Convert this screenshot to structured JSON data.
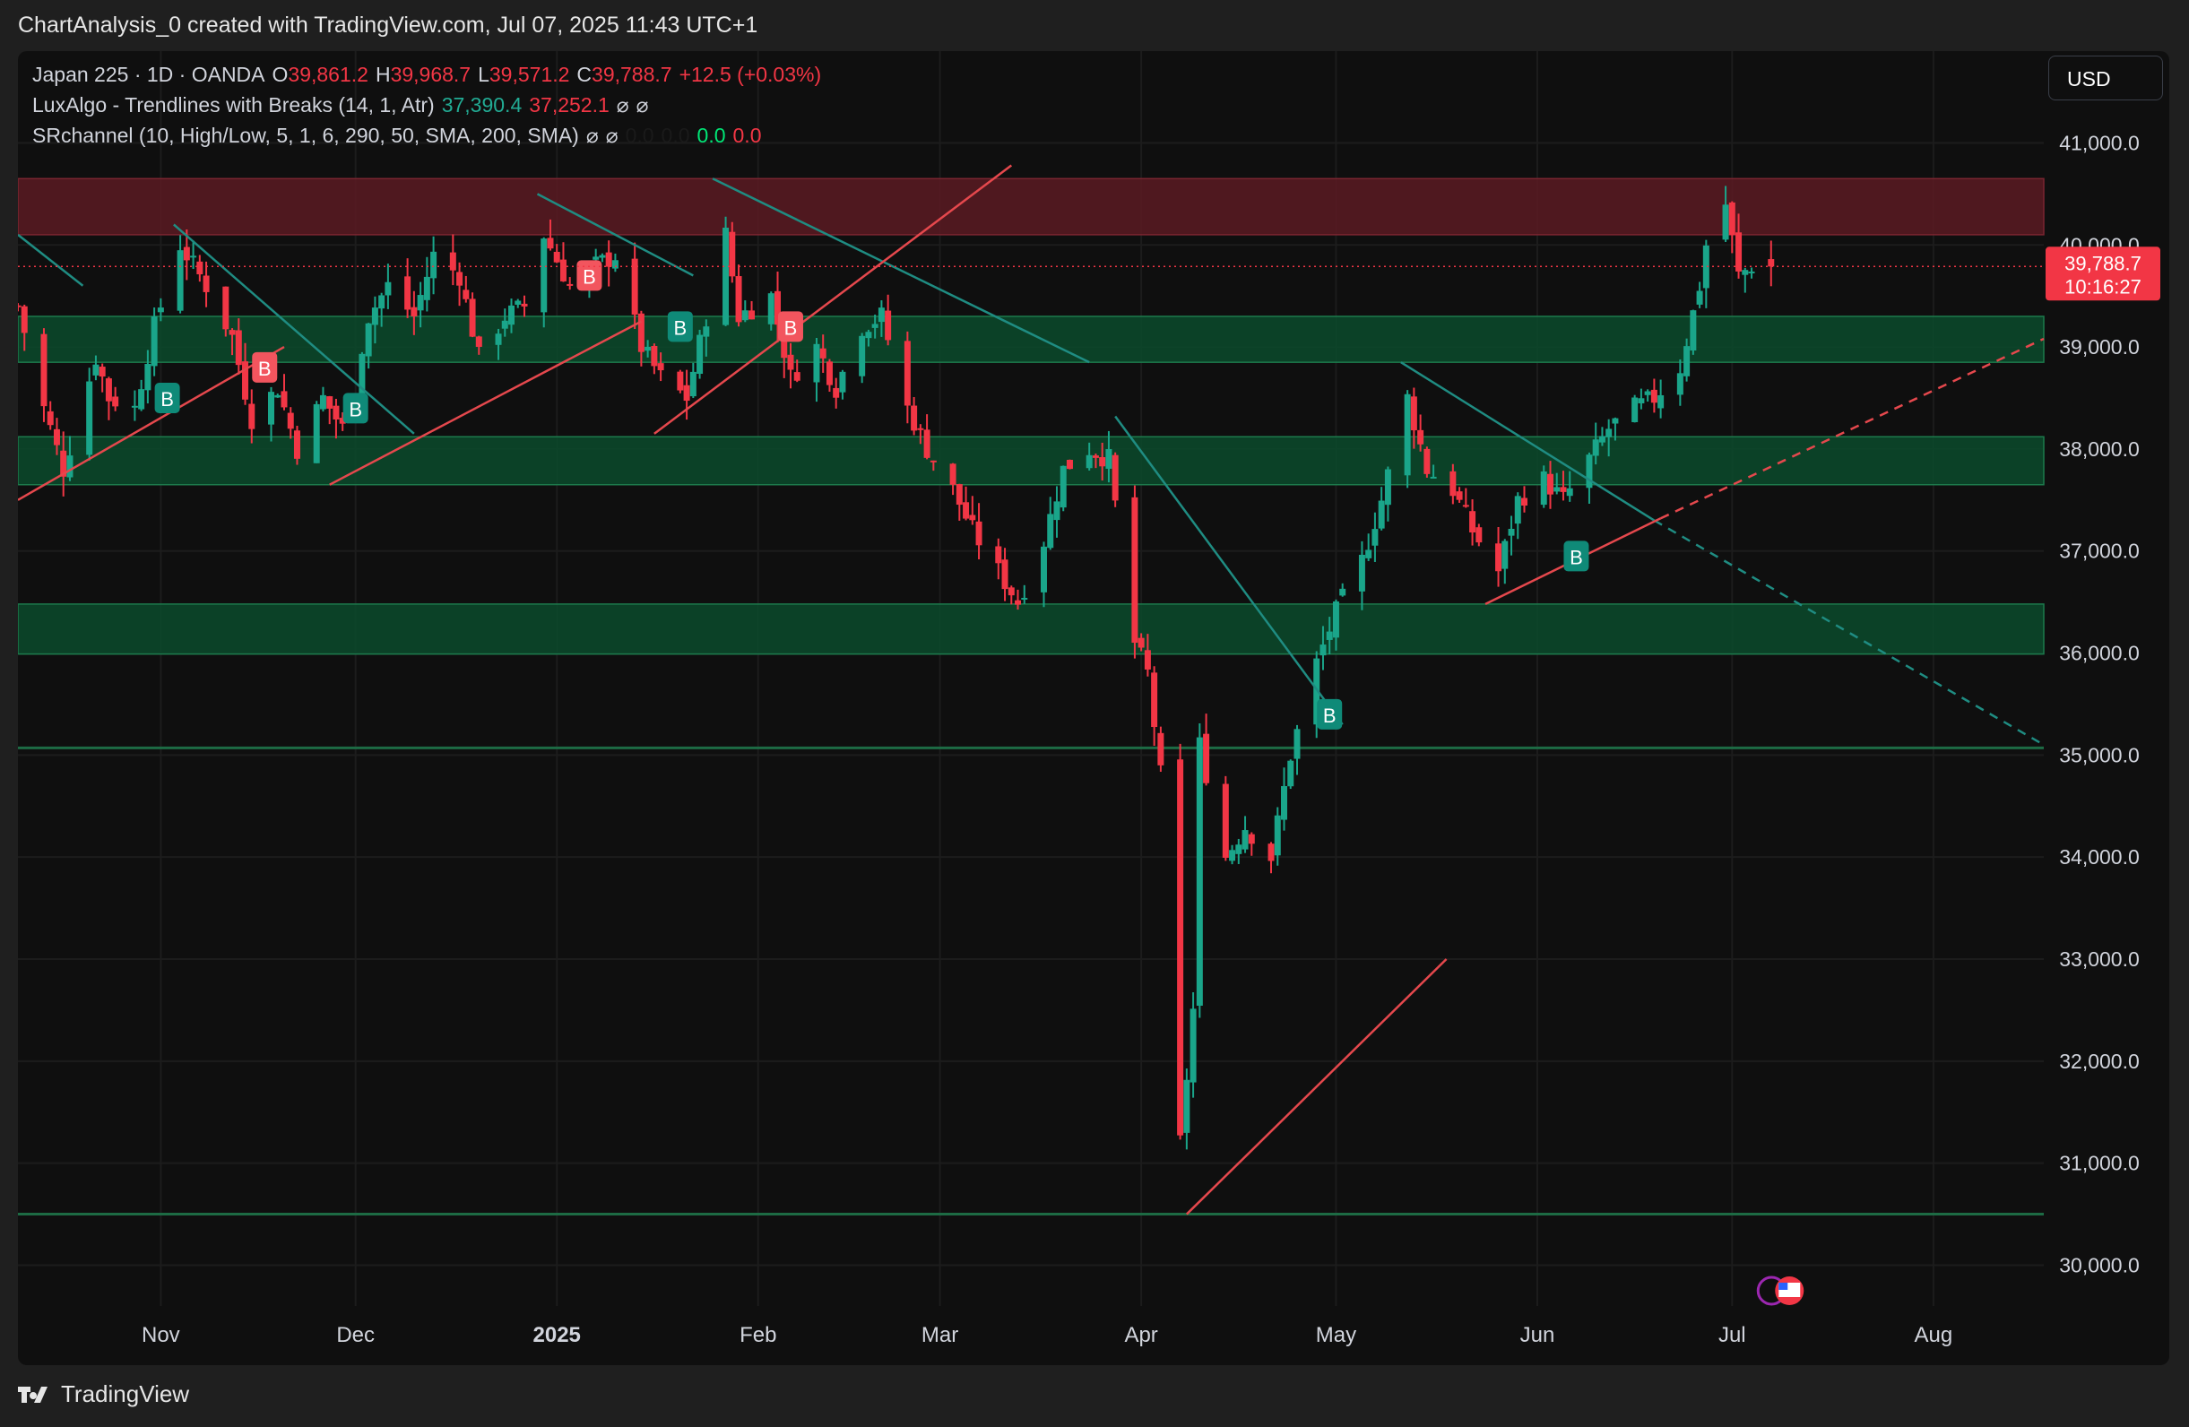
{
  "header": {
    "caption": "ChartAnalysis_0 created with TradingView.com, Jul 07, 2025 11:43 UTC+1"
  },
  "legend": {
    "symbol": "Japan 225 · 1D · OANDA",
    "open_label": "O",
    "open": "39,861.2",
    "high_label": "H",
    "high": "39,968.7",
    "low_label": "L",
    "low": "39,571.2",
    "close_label": "C",
    "close": "39,788.7",
    "change": "+12.5 (+0.03%)",
    "indicator1_name": "LuxAlgo - Trendlines with Breaks (14, 1, Atr)",
    "indicator1_v1": "37,390.4",
    "indicator1_v2": "37,252.1",
    "indicator2_name": "SRchannel (10, High/Low, 5, 1, 6, 290, 50, SMA, 200, SMA)",
    "indicator2_v1": "0.0",
    "indicator2_v2": "0.0",
    "indicator2_v3": "0.0",
    "indicator2_v4": "0.0",
    "hidden_symbol": "⌀"
  },
  "currency_button": "USD",
  "price_tag": {
    "price": "39,788.7",
    "countdown": "10:16:27"
  },
  "footer": {
    "brand": "TradingView",
    "logo": "tradingview-logo-icon"
  },
  "colors": {
    "up": "#1aa58a",
    "down": "#f23645",
    "support_zone": "#0b4a2c",
    "resistance_zone": "#5a1a22",
    "trend_teal": "#1f8c82",
    "trend_red": "#e5484d"
  },
  "chart_data": {
    "type": "candlestick",
    "x_ticks": [
      {
        "label": "Nov",
        "date": "2024-11-01"
      },
      {
        "label": "Dec",
        "date": "2024-12-01"
      },
      {
        "label": "2025",
        "date": "2025-01-01"
      },
      {
        "label": "Feb",
        "date": "2025-02-01"
      },
      {
        "label": "Mar",
        "date": "2025-03-01"
      },
      {
        "label": "Apr",
        "date": "2025-04-01"
      },
      {
        "label": "May",
        "date": "2025-05-01"
      },
      {
        "label": "Jun",
        "date": "2025-06-01"
      },
      {
        "label": "Jul",
        "date": "2025-07-01"
      },
      {
        "label": "Aug",
        "date": "2025-08-01"
      }
    ],
    "x_range": [
      "2024-10-10",
      "2025-08-18"
    ],
    "y_ticks": [
      "41,000.0",
      "40,000.0",
      "39,000.0",
      "38,000.0",
      "37,000.0",
      "36,000.0",
      "35,000.0",
      "34,000.0",
      "33,000.0",
      "32,000.0",
      "31,000.0",
      "30,000.0"
    ],
    "y_range": [
      29600,
      41900
    ],
    "last_price": 39788.7,
    "close_path": [
      [
        "2024-10-10",
        39400
      ],
      [
        "2024-10-14",
        38400
      ],
      [
        "2024-10-17",
        37800
      ],
      [
        "2024-10-22",
        38900
      ],
      [
        "2024-10-24",
        38500
      ],
      [
        "2024-10-28",
        38400
      ],
      [
        "2024-10-31",
        39200
      ],
      [
        "2024-11-04",
        40000
      ],
      [
        "2024-11-08",
        39600
      ],
      [
        "2024-11-12",
        39100
      ],
      [
        "2024-11-15",
        38300
      ],
      [
        "2024-11-19",
        38600
      ],
      [
        "2024-11-22",
        38000
      ],
      [
        "2024-11-26",
        38500
      ],
      [
        "2024-11-29",
        38200
      ],
      [
        "2024-12-03",
        39300
      ],
      [
        "2024-12-06",
        39600
      ],
      [
        "2024-12-10",
        39300
      ],
      [
        "2024-12-13",
        39900
      ],
      [
        "2024-12-17",
        39700
      ],
      [
        "2024-12-20",
        38900
      ],
      [
        "2024-12-24",
        39300
      ],
      [
        "2024-12-27",
        39400
      ],
      [
        "2024-12-30",
        40100
      ],
      [
        "2025-01-03",
        39600
      ],
      [
        "2025-01-07",
        39800
      ],
      [
        "2025-01-10",
        39900
      ],
      [
        "2025-01-14",
        39000
      ],
      [
        "2025-01-17",
        38700
      ],
      [
        "2025-01-21",
        38500
      ],
      [
        "2025-01-24",
        39300
      ],
      [
        "2025-01-27",
        40100
      ],
      [
        "2025-01-29",
        39300
      ],
      [
        "2025-02-03",
        39500
      ],
      [
        "2025-02-06",
        38700
      ],
      [
        "2025-02-10",
        39000
      ],
      [
        "2025-02-13",
        38600
      ],
      [
        "2025-02-17",
        39200
      ],
      [
        "2025-02-20",
        39300
      ],
      [
        "2025-02-24",
        38400
      ],
      [
        "2025-02-27",
        38000
      ],
      [
        "2025-03-03",
        37600
      ],
      [
        "2025-03-06",
        37200
      ],
      [
        "2025-03-10",
        36800
      ],
      [
        "2025-03-13",
        36500
      ],
      [
        "2025-03-17",
        37100
      ],
      [
        "2025-03-20",
        37800
      ],
      [
        "2025-03-24",
        38000
      ],
      [
        "2025-03-27",
        37900
      ],
      [
        "2025-03-31",
        36100
      ],
      [
        "2025-04-02",
        35800
      ],
      [
        "2025-04-04",
        34800
      ],
      [
        "2025-04-07",
        31200
      ],
      [
        "2025-04-09",
        32500
      ],
      [
        "2025-04-10",
        35100
      ],
      [
        "2025-04-14",
        34000
      ],
      [
        "2025-04-17",
        34300
      ],
      [
        "2025-04-21",
        34000
      ],
      [
        "2025-04-24",
        35000
      ],
      [
        "2025-04-28",
        35900
      ],
      [
        "2025-05-01",
        36400
      ],
      [
        "2025-05-05",
        36900
      ],
      [
        "2025-05-08",
        37500
      ],
      [
        "2025-05-12",
        38500
      ],
      [
        "2025-05-15",
        37800
      ],
      [
        "2025-05-19",
        37600
      ],
      [
        "2025-05-22",
        37200
      ],
      [
        "2025-05-26",
        36800
      ],
      [
        "2025-05-29",
        37500
      ],
      [
        "2025-06-02",
        37700
      ],
      [
        "2025-06-05",
        37500
      ],
      [
        "2025-06-09",
        37900
      ],
      [
        "2025-06-12",
        38200
      ],
      [
        "2025-06-16",
        38400
      ],
      [
        "2025-06-19",
        38500
      ],
      [
        "2025-06-23",
        38800
      ],
      [
        "2025-06-26",
        39600
      ],
      [
        "2025-06-27",
        40000
      ],
      [
        "2025-06-30",
        40400
      ],
      [
        "2025-07-02",
        39700
      ],
      [
        "2025-07-04",
        39800
      ],
      [
        "2025-07-07",
        39788.7
      ]
    ],
    "zones": [
      {
        "type": "resistance",
        "from": 40100,
        "to": 40650
      },
      {
        "type": "support",
        "from": 38850,
        "to": 39300
      },
      {
        "type": "support",
        "from": 37650,
        "to": 38120
      },
      {
        "type": "support",
        "from": 35990,
        "to": 36480
      }
    ],
    "horizontal_lines": [
      35070,
      30500
    ],
    "trendlines": [
      {
        "color": "teal",
        "from": [
          "2024-10-10",
          40100
        ],
        "to": [
          "2024-10-20",
          39600
        ]
      },
      {
        "color": "teal",
        "from": [
          "2024-11-03",
          40200
        ],
        "to": [
          "2024-12-10",
          38150
        ]
      },
      {
        "color": "teal",
        "from": [
          "2024-12-29",
          40500
        ],
        "to": [
          "2025-01-22",
          39700
        ]
      },
      {
        "color": "teal",
        "from": [
          "2025-01-25",
          40650
        ],
        "to": [
          "2025-03-24",
          38850
        ]
      },
      {
        "color": "teal",
        "from": [
          "2025-03-28",
          38320
        ],
        "to": [
          "2025-05-02",
          35300
        ]
      },
      {
        "color": "teal",
        "from": [
          "2025-05-11",
          38850
        ],
        "to": [
          "2025-06-19",
          37300
        ]
      },
      {
        "color": "teal",
        "dashed": true,
        "from": [
          "2025-06-19",
          37300
        ],
        "to": [
          "2025-08-18",
          35100
        ]
      },
      {
        "color": "red",
        "from": [
          "2024-10-10",
          37500
        ],
        "to": [
          "2024-11-20",
          39000
        ]
      },
      {
        "color": "red",
        "from": [
          "2024-11-27",
          37650
        ],
        "to": [
          "2025-01-14",
          39250
        ]
      },
      {
        "color": "red",
        "from": [
          "2025-01-16",
          38150
        ],
        "to": [
          "2025-03-12",
          40780
        ]
      },
      {
        "color": "red",
        "from": [
          "2025-04-08",
          30500
        ],
        "to": [
          "2025-05-18",
          33000
        ]
      },
      {
        "color": "red",
        "from": [
          "2025-05-24",
          36480
        ],
        "to": [
          "2025-06-20",
          37320
        ]
      },
      {
        "color": "red",
        "dashed": true,
        "from": [
          "2025-06-20",
          37320
        ],
        "to": [
          "2025-08-18",
          39080
        ]
      }
    ],
    "break_markers": [
      {
        "label": "B",
        "date": "2024-11-02",
        "price": 38500,
        "kind": "bullish"
      },
      {
        "label": "B",
        "date": "2024-11-17",
        "price": 38800,
        "kind": "bearish"
      },
      {
        "label": "B",
        "date": "2024-12-01",
        "price": 38400,
        "kind": "bullish"
      },
      {
        "label": "B",
        "date": "2025-01-06",
        "price": 39700,
        "kind": "bearish"
      },
      {
        "label": "B",
        "date": "2025-01-20",
        "price": 39200,
        "kind": "bullish"
      },
      {
        "label": "B",
        "date": "2025-02-06",
        "price": 39200,
        "kind": "bearish"
      },
      {
        "label": "B",
        "date": "2025-04-30",
        "price": 35400,
        "kind": "bullish"
      },
      {
        "label": "B",
        "date": "2025-06-07",
        "price": 36950,
        "kind": "bullish"
      }
    ]
  }
}
